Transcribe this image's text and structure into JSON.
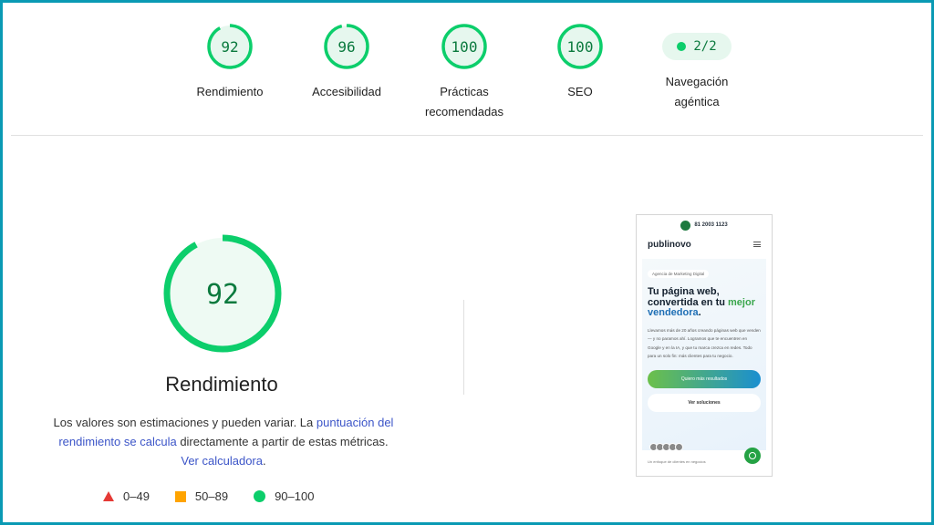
{
  "gauges": [
    {
      "score": "92",
      "label": "Rendimiento"
    },
    {
      "score": "96",
      "label": "Accesibilidad"
    },
    {
      "score": "100",
      "label": "Prácticas recomendadas"
    },
    {
      "score": "100",
      "label": "SEO"
    }
  ],
  "agentic": {
    "value": "2/2",
    "label": "Navegación agéntica"
  },
  "detail": {
    "score": "92",
    "title": "Rendimiento",
    "desc_text1": "Los valores son estimaciones y pueden variar. La ",
    "desc_link1": "puntuación del rendimiento se calcula",
    "desc_text2": " directamente a partir de estas métricas. ",
    "desc_link2": "Ver calculadora",
    "desc_text3": "."
  },
  "legend": [
    {
      "range": "0–49",
      "shape": "triangle",
      "color": "#e53935"
    },
    {
      "range": "50–89",
      "shape": "square",
      "color": "#ffa400"
    },
    {
      "range": "90–100",
      "shape": "circle",
      "color": "#0cce6b"
    }
  ],
  "screenshot": {
    "phone_number": "81 2003 1123",
    "logo": "publinovo",
    "chip": "Agencia de Marketing Digital",
    "h1_part1": "Tu página web, convertida en tu ",
    "h1_part2": "mejor",
    "h1_part3": "vendedora",
    "h1_part4": ".",
    "paragraph": "Llevamos más de 20 años creando páginas web que venden — y no paramos ahí. Logramos que te encuentren en Google y en la IA, y que tu marca crezca en redes. Todo para un solo fin: más clientes para tu negocio.",
    "btn_primary": "Quiero más resultados",
    "btn_secondary": "Ver soluciones",
    "footer": "Un enfoque de clientes en negocios"
  },
  "colors": {
    "good": "#0cce6b",
    "good_text": "#0b7a3e",
    "good_bg": "#e6f7ee",
    "link": "#3c55c8"
  }
}
